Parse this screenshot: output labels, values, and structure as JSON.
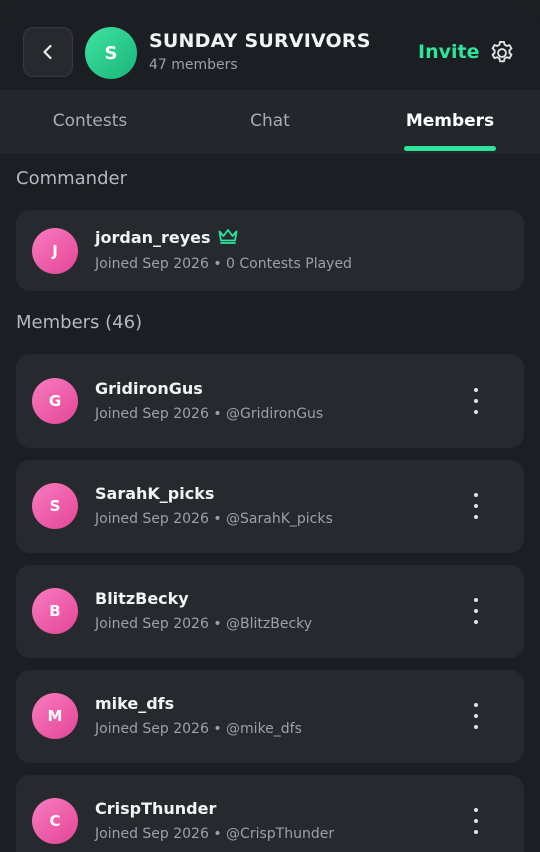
{
  "header": {
    "back_label": "Back",
    "group_initial": "S",
    "group_name": "SUNDAY SURVIVORS",
    "member_count": "47 members",
    "invite_label": "Invite"
  },
  "tabs": [
    {
      "label": "Contests",
      "active": false
    },
    {
      "label": "Chat",
      "active": false
    },
    {
      "label": "Members",
      "active": true
    }
  ],
  "commander": {
    "section_title": "Commander",
    "initial": "J",
    "name": "jordan_reyes",
    "joined": "Joined Sep 2026",
    "separator": "•",
    "detail": "0 Contests Played"
  },
  "members": {
    "section_title": "Members (46)",
    "items": [
      {
        "initial": "G",
        "name": "GridironGus",
        "joined": "Joined Sep 2026",
        "separator": "•",
        "handle": "@GridironGus"
      },
      {
        "initial": "S",
        "name": "SarahK_picks",
        "joined": "Joined Sep 2026",
        "separator": "•",
        "handle": "@SarahK_picks"
      },
      {
        "initial": "B",
        "name": "BlitzBecky",
        "joined": "Joined Sep 2026",
        "separator": "•",
        "handle": "@BlitzBecky"
      },
      {
        "initial": "M",
        "name": "mike_dfs",
        "joined": "Joined Sep 2026",
        "separator": "•",
        "handle": "@mike_dfs"
      },
      {
        "initial": "C",
        "name": "CrispThunder",
        "joined": "Joined Sep 2026",
        "separator": "•",
        "handle": "@CrispThunder"
      }
    ]
  },
  "colors": {
    "accent": "#2ee39a",
    "background": "#1b1e22",
    "card": "#262a2f",
    "avatar_pink": "#ec5aa8"
  },
  "icons": {
    "back": "chevron-left-icon",
    "settings": "gear-icon",
    "commander": "crown-icon",
    "more": "kebab-menu-icon"
  }
}
